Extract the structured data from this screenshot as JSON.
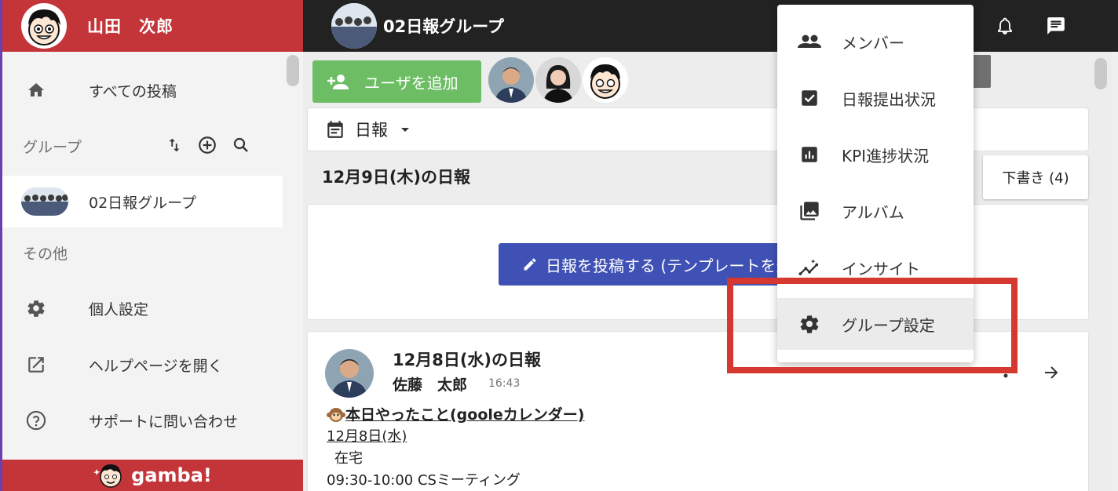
{
  "sidebar": {
    "user_name": "山田　次郎",
    "all_posts": "すべての投稿",
    "groups_header": "グループ",
    "group_item": "02日報グループ",
    "other_header": "その他",
    "personal_settings": "個人設定",
    "open_help": "ヘルプページを開く",
    "contact_support": "サポートに問い合わせ",
    "footer_brand": "gamba!"
  },
  "topbar": {
    "group_title": "02日報グループ"
  },
  "main": {
    "add_user_label": "ユーザを追加",
    "filter_label": "日報",
    "date_heading": "12月9日(木)の日報",
    "draft_label": "下書き (4)",
    "post_button_label": "日報を投稿する (テンプレートを選択)",
    "report": {
      "title": "12月8日(水)の日報",
      "author": "佐藤　太郎",
      "time": "16:43",
      "section_heading": "本日やったこと(gooleカレンダー)",
      "date_link": "12月8日(水)",
      "line1": "在宅",
      "line2": "09:30-10:00  CSミーティング"
    }
  },
  "dropdown": {
    "items": [
      {
        "label": "メンバー",
        "icon": "people-icon"
      },
      {
        "label": "日報提出状況",
        "icon": "checkbox-icon"
      },
      {
        "label": "KPI進捗状況",
        "icon": "bar-chart-icon"
      },
      {
        "label": "アルバム",
        "icon": "photo-library-icon"
      },
      {
        "label": "インサイト",
        "icon": "insights-icon"
      },
      {
        "label": "グループ設定",
        "icon": "gear-icon"
      }
    ]
  },
  "colors": {
    "brand_red": "#c4353a",
    "topbar": "#222222",
    "add_user_green": "#6cbd64",
    "post_blue": "#3f51b5",
    "highlight_red": "#d4382e"
  }
}
